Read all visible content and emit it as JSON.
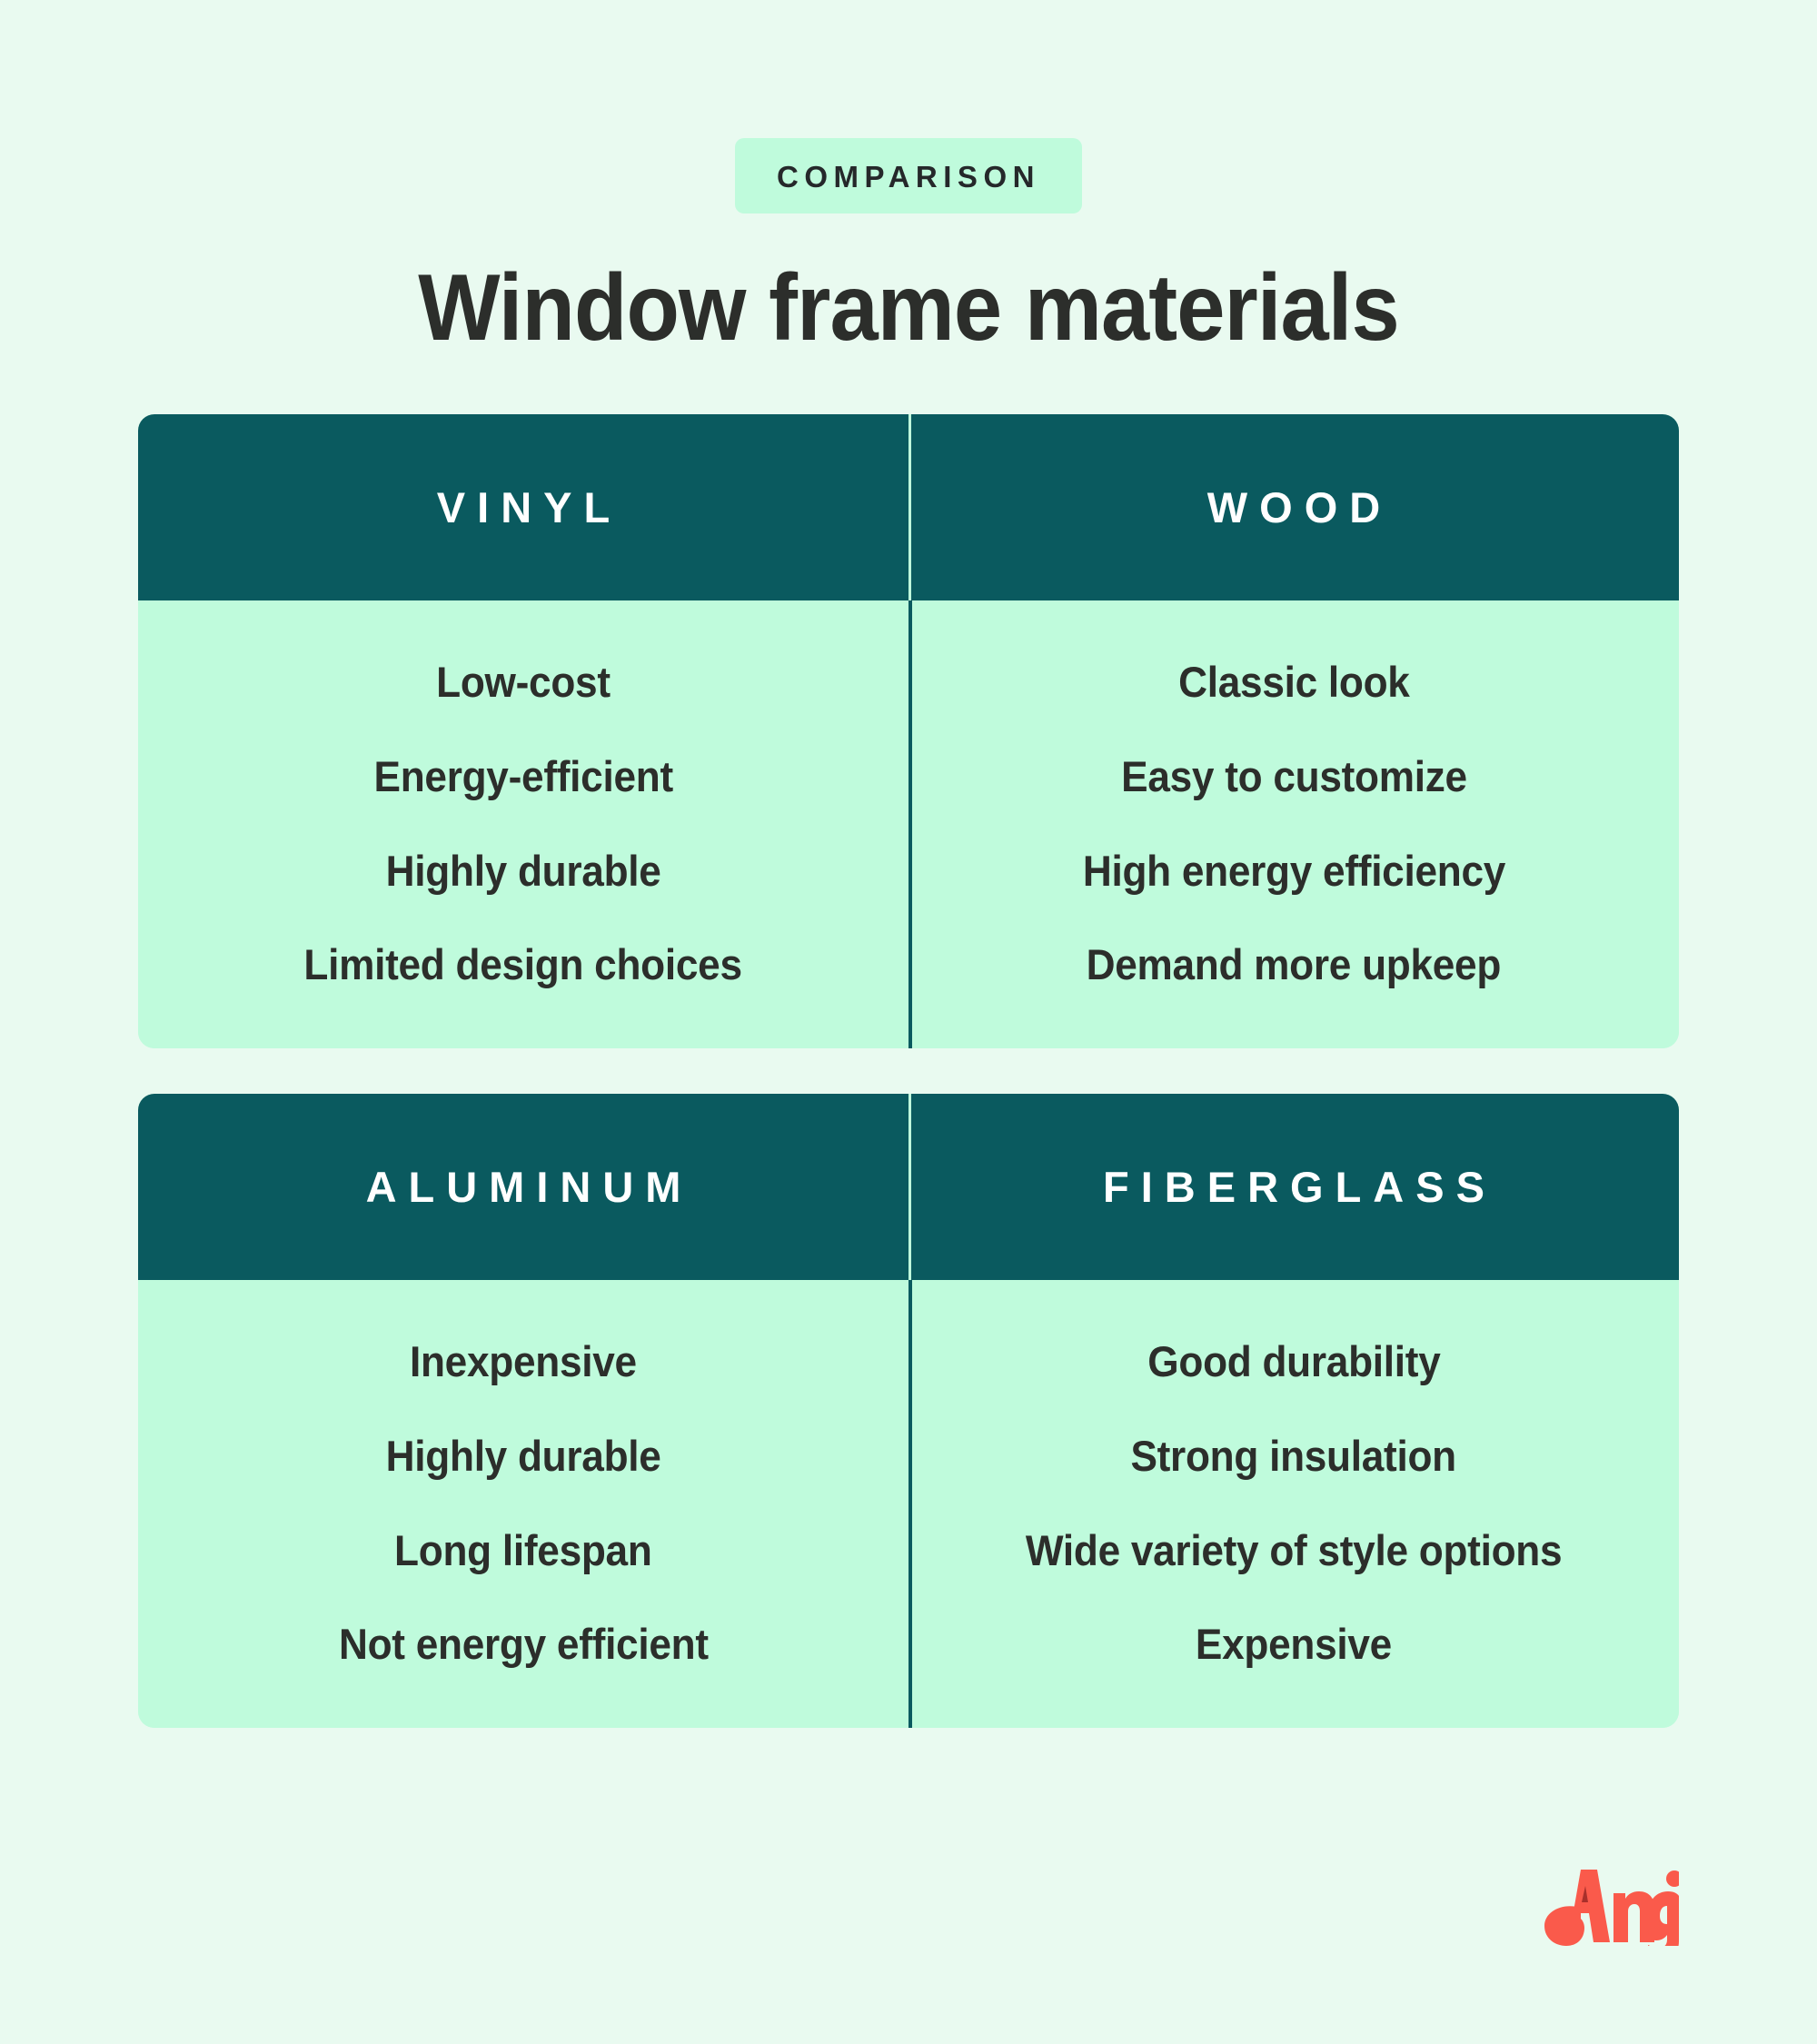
{
  "header": {
    "badge_label": "COMPARISON",
    "title": "Window frame materials"
  },
  "colors": {
    "page_background": "#E9FAF0",
    "card_header_teal": "#0A5A5F",
    "card_body_mint": "#BFFBDC",
    "text_dark": "#2C2E2B",
    "header_text": "#FFFFFF",
    "logo_coral": "#FA5A4B"
  },
  "comparison": {
    "cards": [
      {
        "columns": [
          {
            "name": "VINYL",
            "features": [
              "Low-cost",
              "Energy-efficient",
              "Highly durable",
              "Limited design choices"
            ]
          },
          {
            "name": "WOOD",
            "features": [
              "Classic look",
              "Easy to customize",
              "High energy efficiency",
              "Demand more upkeep"
            ]
          }
        ]
      },
      {
        "columns": [
          {
            "name": "ALUMINUM",
            "features": [
              "Inexpensive",
              "Highly durable",
              "Long lifespan",
              "Not energy efficient"
            ]
          },
          {
            "name": "FIBERGLASS",
            "features": [
              "Good durability",
              "Strong insulation",
              "Wide variety of style options",
              "Expensive"
            ]
          }
        ]
      }
    ]
  },
  "branding": {
    "logo_text": "Angi"
  }
}
